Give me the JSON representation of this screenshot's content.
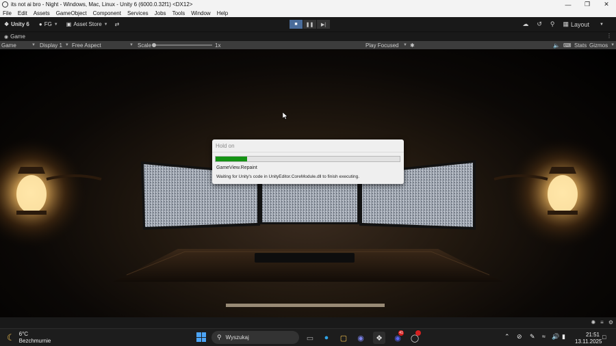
{
  "window": {
    "title": "its not ai bro - Night - Windows, Mac, Linux - Unity 6 (6000.0.32f1) <DX12>",
    "icon": "unity-logo-icon",
    "controls": [
      "minimize-icon",
      "restore-icon",
      "close-icon"
    ]
  },
  "menu": [
    "File",
    "Edit",
    "Assets",
    "GameObject",
    "Component",
    "Services",
    "Jobs",
    "Tools",
    "Window",
    "Help"
  ],
  "toolbar": {
    "unity_label": "Unity 6",
    "account_label": "FG",
    "asset_store_label": "Asset Store",
    "layout_label": "Layout",
    "play_state": "playing"
  },
  "tab": {
    "label": "Game"
  },
  "gamebar": {
    "view_select": "Game",
    "display_select": "Display 1",
    "aspect_select": "Free Aspect",
    "scale_label": "Scale",
    "scale_value": "1x",
    "play_mode_select": "Play Focused",
    "stats_label": "Stats",
    "gizmos_label": "Gizmos"
  },
  "dialog": {
    "title": "Hold on",
    "progress": 0.17,
    "task": "GameView.Repaint",
    "message": "Waiting for Unity's code in UnityEditor.CoreModule.dll to finish executing."
  },
  "taskbar": {
    "weather_temp": "6°C",
    "weather_desc": "Bezchmurnie",
    "search_placeholder": "Wyszukaj",
    "discord_badge": "41",
    "time": "21:51",
    "date": "13.11.2025"
  },
  "colors": {
    "progress_fill": "#149314",
    "editor_dark": "#191919",
    "play_active": "#4a6c9a"
  }
}
